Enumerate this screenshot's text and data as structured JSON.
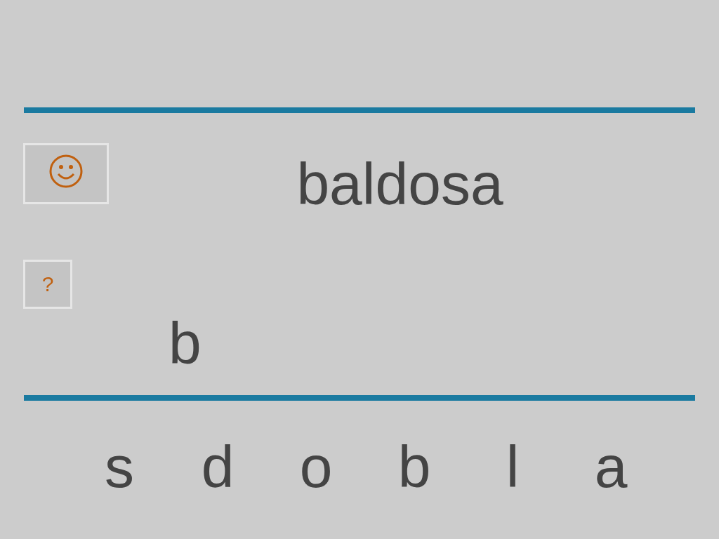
{
  "prompt_word": "baldosa",
  "hint_button": {
    "label": "?"
  },
  "answer": {
    "letters": [
      "b"
    ]
  },
  "letter_tiles": [
    {
      "letter": "s"
    },
    {
      "letter": "d"
    },
    {
      "letter": "o"
    },
    {
      "letter": "b"
    },
    {
      "letter": "l"
    },
    {
      "letter": "a"
    }
  ]
}
